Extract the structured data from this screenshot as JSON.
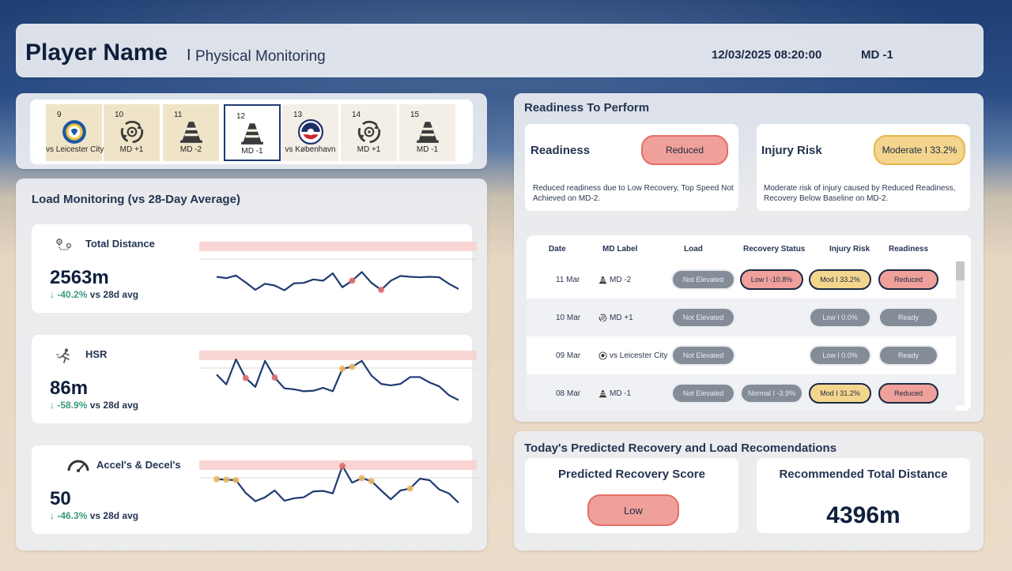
{
  "header": {
    "player_name": "Player Name",
    "separator": "I",
    "subtitle": "Physical Monitoring",
    "datetime": "12/03/2025 08:20:00",
    "md": "MD -1"
  },
  "fixtures": [
    {
      "day": "9",
      "label": "vs Leicester City",
      "icon": "leicester-crest-icon"
    },
    {
      "day": "10",
      "label": "MD +1",
      "icon": "recovery-icon"
    },
    {
      "day": "11",
      "label": "MD -2",
      "icon": "cone-icon"
    },
    {
      "day": "12",
      "label": "MD -1",
      "icon": "cone-icon",
      "selected": true
    },
    {
      "day": "13",
      "label": "vs København",
      "icon": "kobenhavn-crest-icon"
    },
    {
      "day": "14",
      "label": "MD +1",
      "icon": "recovery-icon"
    },
    {
      "day": "15",
      "label": "MD -1",
      "icon": "cone-icon"
    }
  ],
  "load": {
    "title": "Load Monitoring (vs 28-Day Average)",
    "metrics": [
      {
        "name": "Total Distance",
        "icon": "distance-route-icon",
        "value": "2563m",
        "arrow": "↓",
        "delta": "-40.2%",
        "suffix": "vs 28d avg",
        "series": [
          0.7,
          0.73,
          0.67,
          0.83,
          1.0,
          0.86,
          0.9,
          1.01,
          0.85,
          0.84,
          0.76,
          0.79,
          0.62,
          0.94,
          0.79,
          0.59,
          0.84,
          1.0,
          0.79,
          0.68,
          0.7,
          0.71,
          0.7,
          0.71,
          0.86,
          0.98
        ],
        "above": [
          14,
          17
        ]
      },
      {
        "name": "HSR",
        "icon": "sprint-icon",
        "value": "86m",
        "arrow": "↓",
        "delta": "-58.9%",
        "suffix": "vs 28d avg",
        "series": [
          0.36,
          0.56,
          0.05,
          0.43,
          0.61,
          0.08,
          0.42,
          0.64,
          0.66,
          0.7,
          0.69,
          0.63,
          0.7,
          0.24,
          0.2,
          0.08,
          0.38,
          0.55,
          0.58,
          0.55,
          0.41,
          0.41,
          0.52,
          0.6,
          0.78,
          0.88
        ],
        "above": [
          3,
          6
        ],
        "warn": [
          13,
          14
        ]
      },
      {
        "name": "Accel's & Decel's",
        "icon": "speedometer-icon",
        "value": "50",
        "arrow": "↓",
        "delta": "-46.3%",
        "suffix": "vs 28d avg",
        "series": [
          0.27,
          0.28,
          0.29,
          0.55,
          0.72,
          0.64,
          0.5,
          0.71,
          0.66,
          0.64,
          0.52,
          0.51,
          0.56,
          0.0,
          0.34,
          0.25,
          0.31,
          0.5,
          0.68,
          0.5,
          0.46,
          0.26,
          0.29,
          0.48,
          0.56,
          0.75
        ],
        "above": [
          13
        ],
        "warn": [
          0,
          1,
          2,
          15,
          16,
          20
        ]
      }
    ]
  },
  "readiness": {
    "title": "Readiness To Perform",
    "readiness_label": "Readiness",
    "readiness_status": "Reduced",
    "readiness_desc": "Reduced readiness due to Low Recovery, Top Speed Not Achieved on MD-2.",
    "injury_label": "Injury Risk",
    "injury_status": "Moderate I 33.2%",
    "injury_desc": "Moderate risk of injury caused by Reduced Readiness, Recovery Below Baseline on MD-2."
  },
  "table": {
    "headers": [
      "Date",
      "MD Label",
      "Load",
      "Recovery Status",
      "Injury Risk",
      "Readiness"
    ],
    "rows": [
      {
        "date": "11 Mar",
        "md": "MD -2",
        "md_icon": "cone-icon",
        "load": "Not Elevated",
        "recovery": "Low I -10.8%",
        "injury": "Mod I 33.2%",
        "readiness": "Reduced"
      },
      {
        "date": "10 Mar",
        "md": "MD +1",
        "md_icon": "recovery-icon",
        "load": "Not Elevated",
        "recovery": "",
        "injury": "Low I 0.0%",
        "readiness": "Ready"
      },
      {
        "date": "09 Mar",
        "md": "vs Leicester City",
        "md_icon": "football-icon",
        "load": "Not Elevated",
        "recovery": "",
        "injury": "Low I 0.0%",
        "readiness": "Ready"
      },
      {
        "date": "08 Mar",
        "md": "MD -1",
        "md_icon": "cone-icon",
        "load": "Not Elevated",
        "recovery": "Normal I -3.9%",
        "injury": "Mod I 31.2%",
        "readiness": "Reduced"
      }
    ]
  },
  "predicted": {
    "title": "Today's Predicted Recovery and Load Recomendations",
    "recovery_title": "Predicted Recovery Score",
    "recovery_value": "Low",
    "distance_title": "Recommended Total Distance",
    "distance_value": "4396m"
  },
  "colors": {
    "navy": "#1f3a73",
    "good": "#3a9a7d",
    "red": "#f0a09a",
    "amber": "#f3d58d",
    "grey": "#848c98",
    "band": "#f8d5d3"
  }
}
